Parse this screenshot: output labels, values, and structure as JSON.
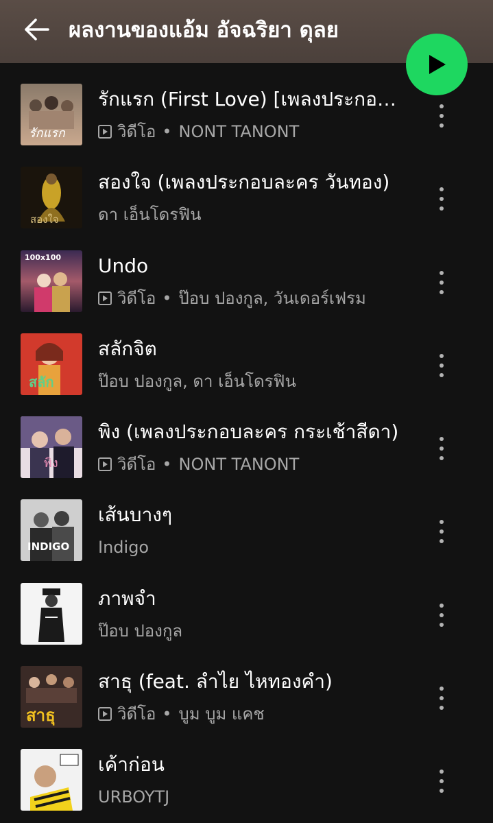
{
  "header": {
    "title": "ผลงานของแอ้ม อัจฉริยา ดุลย",
    "back_icon": "arrow-left-icon",
    "play_icon": "play-icon",
    "accent_color": "#1ed760"
  },
  "tracks": [
    {
      "title": "รักแรก (First Love) [เพลงประกอบละคร...",
      "has_video": true,
      "video_label": "วิดีโอ",
      "artist": "NONT TANONT"
    },
    {
      "title": "สองใจ (เพลงประกอบละคร วันทอง)",
      "has_video": false,
      "video_label": "",
      "artist": "ดา เอ็นโดรฟิน"
    },
    {
      "title": "Undo",
      "has_video": true,
      "video_label": "วิดีโอ",
      "artist": "ป๊อบ ปองกูล, วันเดอร์เฟรม"
    },
    {
      "title": "สลักจิต",
      "has_video": false,
      "video_label": "",
      "artist": "ป๊อบ ปองกูล, ดา เอ็นโดรฟิน"
    },
    {
      "title": "พิง (เพลงประกอบละคร กระเช้าสีดา)",
      "has_video": true,
      "video_label": "วิดีโอ",
      "artist": "NONT TANONT"
    },
    {
      "title": "เส้นบางๆ",
      "has_video": false,
      "video_label": "",
      "artist": "Indigo"
    },
    {
      "title": "ภาพจำ",
      "has_video": false,
      "video_label": "",
      "artist": "ป๊อบ ปองกูล"
    },
    {
      "title": "สาธุ (feat. ลำไย ไหทองคำ)",
      "has_video": true,
      "video_label": "วิดีโอ",
      "artist": "บูม บูม แคช"
    },
    {
      "title": "เค้าก่อน",
      "has_video": false,
      "video_label": "",
      "artist": "URBOYTJ"
    }
  ],
  "more_icon": "more-vertical-icon",
  "separator": "•"
}
